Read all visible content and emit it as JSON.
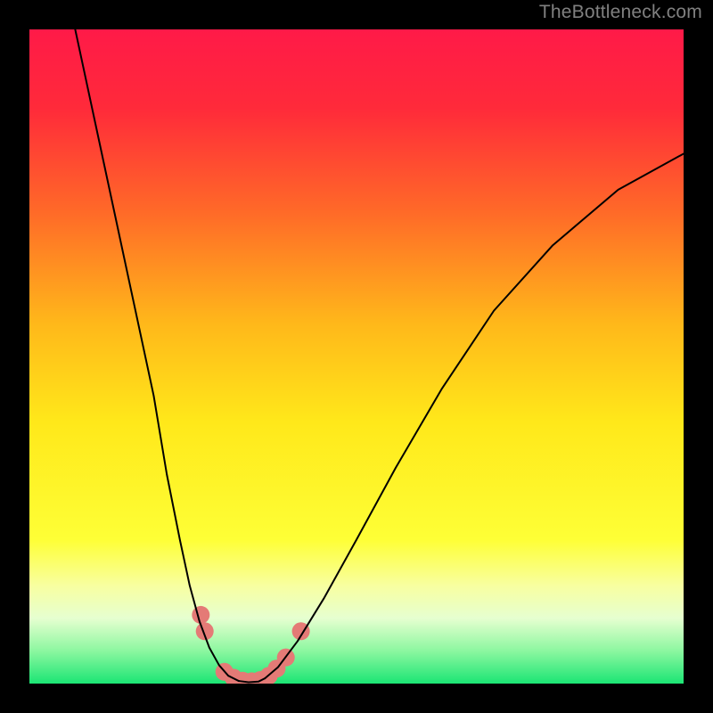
{
  "watermark": "TheBottleneck.com",
  "chart_data": {
    "type": "line",
    "title": "",
    "xlabel": "",
    "ylabel": "",
    "xlim": [
      0,
      100
    ],
    "ylim": [
      0,
      100
    ],
    "background_gradient": {
      "stops": [
        {
          "offset": 0.0,
          "color": "#ff1a48"
        },
        {
          "offset": 0.12,
          "color": "#ff2a3a"
        },
        {
          "offset": 0.28,
          "color": "#ff6a28"
        },
        {
          "offset": 0.45,
          "color": "#ffb81a"
        },
        {
          "offset": 0.6,
          "color": "#ffe81a"
        },
        {
          "offset": 0.78,
          "color": "#feff36"
        },
        {
          "offset": 0.85,
          "color": "#f8ffa0"
        },
        {
          "offset": 0.9,
          "color": "#e6ffd0"
        },
        {
          "offset": 0.95,
          "color": "#8cf7a0"
        },
        {
          "offset": 1.0,
          "color": "#1be574"
        }
      ]
    },
    "series": [
      {
        "name": "left-curve",
        "color": "#000000",
        "width": 2,
        "x": [
          7,
          10,
          13,
          16,
          19,
          21,
          23,
          24.5,
          26,
          27.5,
          29,
          30.4,
          32
        ],
        "y": [
          100,
          86,
          72,
          58,
          44,
          32,
          22,
          15,
          9.5,
          5.5,
          2.8,
          1.2,
          0.4
        ]
      },
      {
        "name": "right-curve",
        "color": "#000000",
        "width": 2,
        "x": [
          36,
          38,
          41,
          45,
          50,
          56,
          63,
          71,
          80,
          90,
          100
        ],
        "y": [
          0.8,
          2.5,
          6.5,
          13,
          22,
          33,
          45,
          57,
          67,
          75.5,
          81
        ]
      },
      {
        "name": "valley-floor",
        "color": "#000000",
        "width": 2,
        "x": [
          32,
          33.5,
          35,
          36
        ],
        "y": [
          0.4,
          0.2,
          0.3,
          0.8
        ]
      }
    ],
    "markers": {
      "name": "highlighted-points",
      "color": "#e47a76",
      "radius": 10,
      "points": [
        {
          "x": 26.2,
          "y": 10.5
        },
        {
          "x": 26.8,
          "y": 8.0
        },
        {
          "x": 29.8,
          "y": 1.8
        },
        {
          "x": 31.2,
          "y": 0.9
        },
        {
          "x": 32.6,
          "y": 0.45
        },
        {
          "x": 34.0,
          "y": 0.35
        },
        {
          "x": 35.3,
          "y": 0.55
        },
        {
          "x": 36.6,
          "y": 1.2
        },
        {
          "x": 37.8,
          "y": 2.3
        },
        {
          "x": 39.2,
          "y": 4.0
        },
        {
          "x": 41.5,
          "y": 8.0
        }
      ]
    }
  }
}
